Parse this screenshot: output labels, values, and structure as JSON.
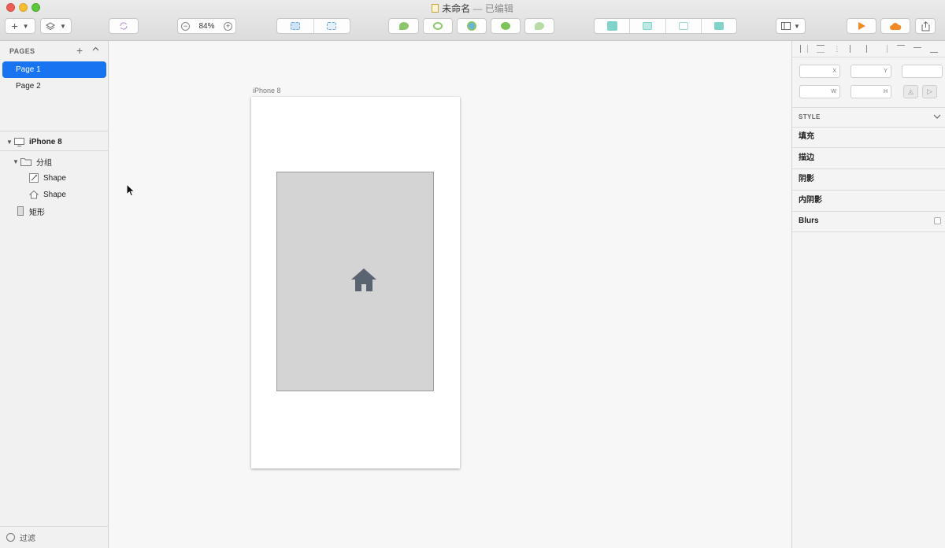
{
  "window": {
    "title": "未命名",
    "title_sep": " — ",
    "title_status": "已编辑"
  },
  "toolbar": {
    "insert_label": "+",
    "zoom_minus": "−",
    "zoom_value": "84%",
    "zoom_plus": "+"
  },
  "pages": {
    "header": "PAGES",
    "add": "+",
    "collapse": "^",
    "items": [
      {
        "label": "Page 1",
        "active": true
      },
      {
        "label": "Page 2",
        "active": false
      }
    ]
  },
  "layers": {
    "artboard": "iPhone 8",
    "group": "分组",
    "shape1": "Shape",
    "shape2": "Shape",
    "rectangle": "矩形"
  },
  "filter": {
    "label": "过滤"
  },
  "canvas": {
    "artboard_label": "iPhone 8"
  },
  "inspector": {
    "x_label": "X",
    "y_label": "Y",
    "w_label": "W",
    "h_label": "H",
    "style_header": "STYLE",
    "rows": {
      "fill": "填充",
      "border": "描边",
      "shadow": "阴影",
      "inner_shadow": "内阴影",
      "blurs": "Blurs"
    }
  },
  "colors": {
    "accent": "#1874f0",
    "rect_fill": "#d4d4d4",
    "home_icon": "#5a6370"
  }
}
